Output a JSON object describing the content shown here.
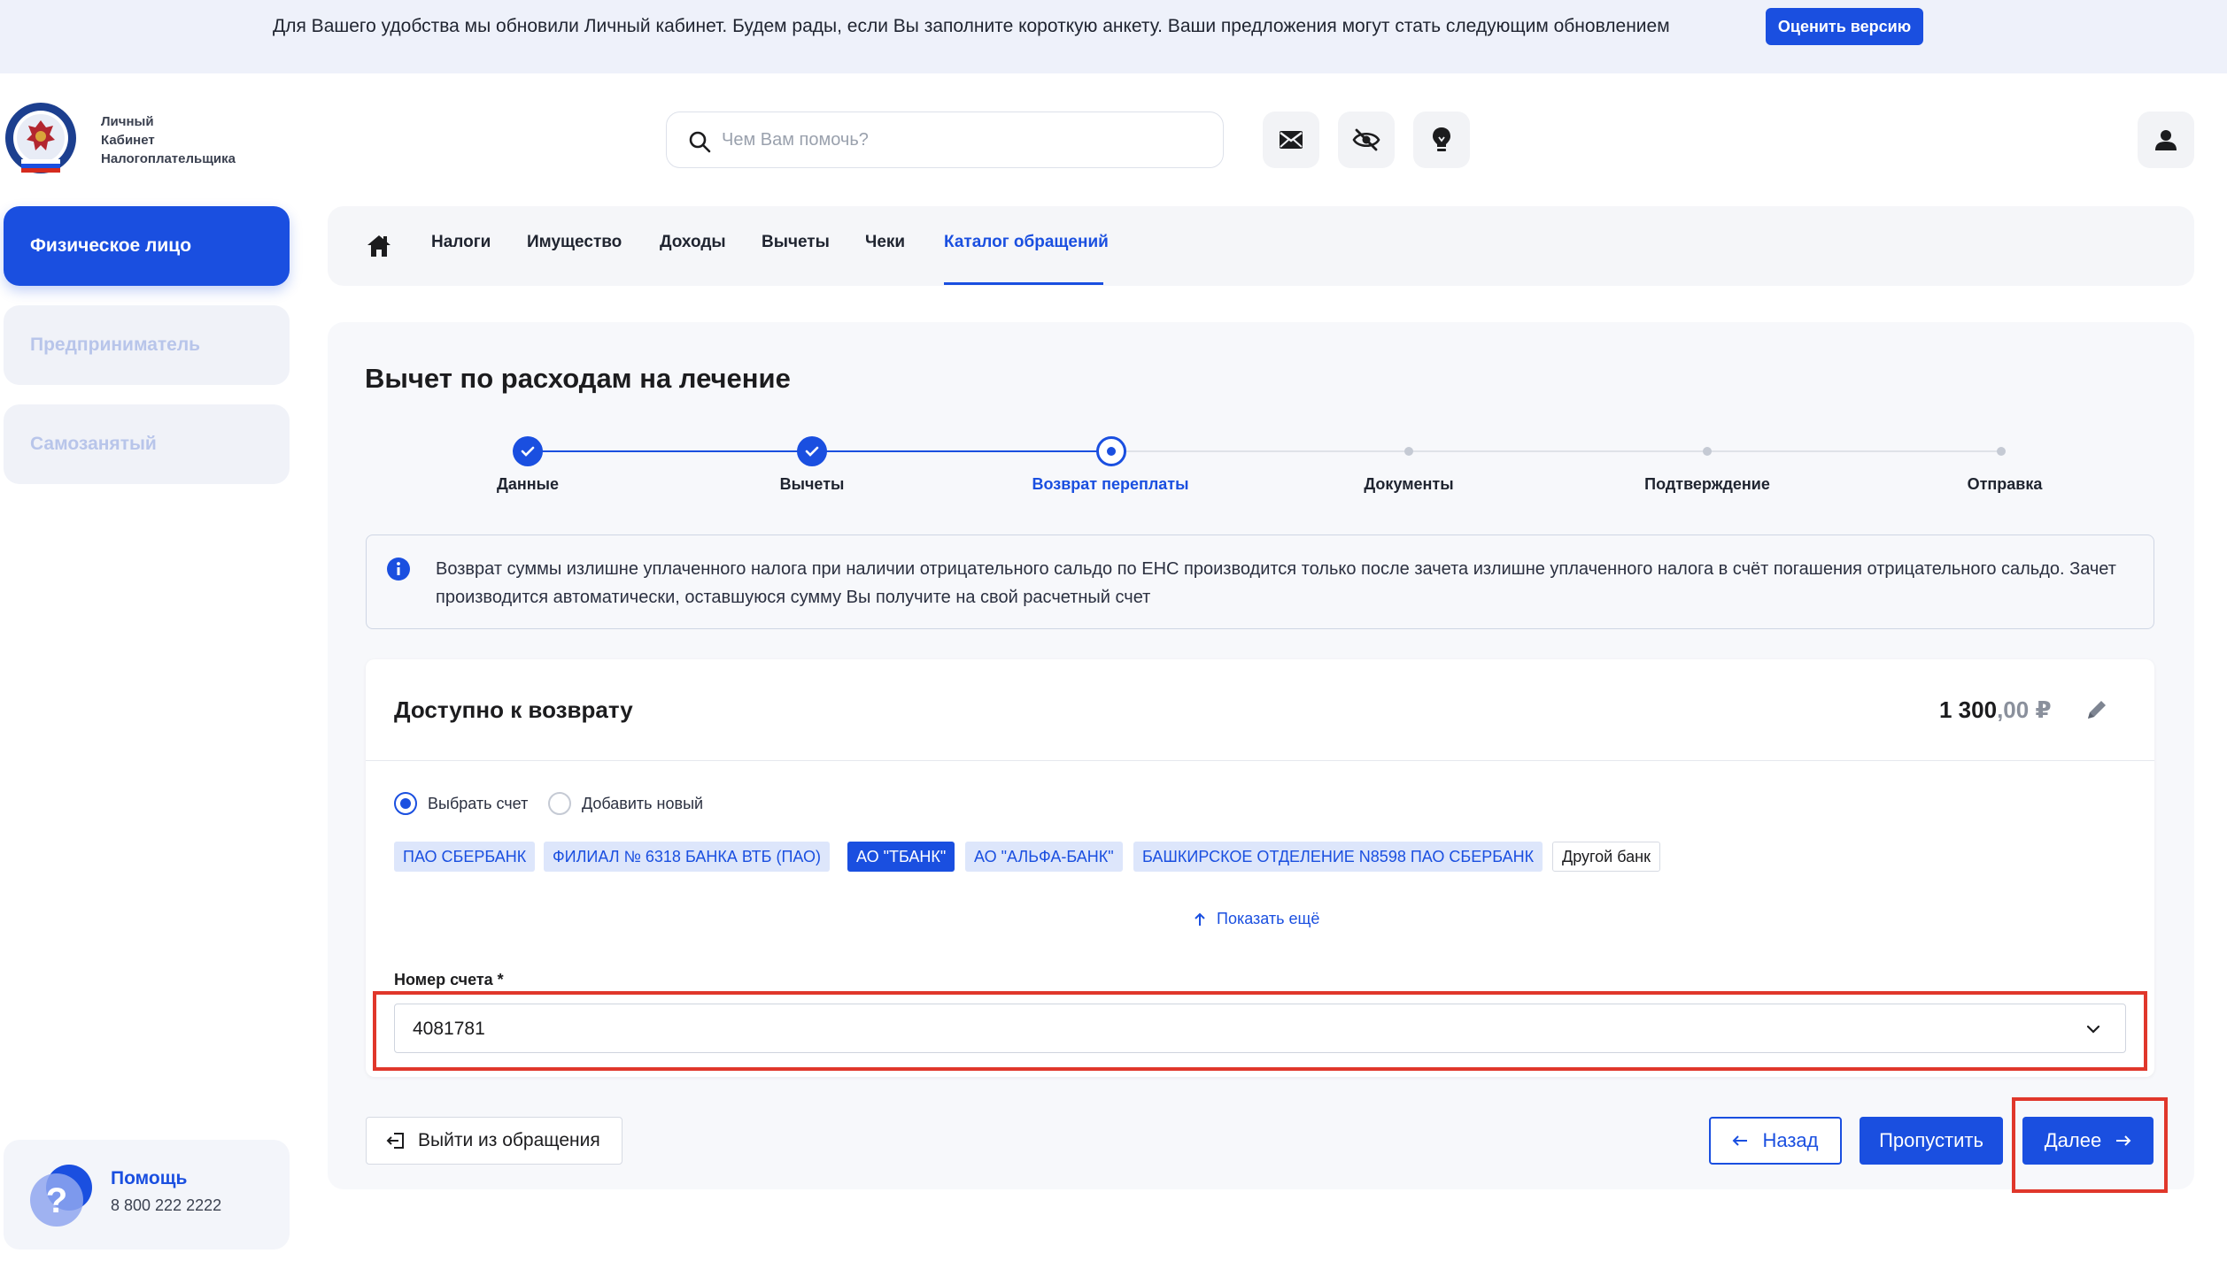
{
  "banner": {
    "text": "Для Вашего удобства мы обновили Личный кабинет. Будем рады, если Вы заполните короткую анкету. Ваши предложения могут стать следующим обновлением",
    "button_label": "Оценить версию"
  },
  "header": {
    "logo_line1": "Личный",
    "logo_line2": "Кабинет",
    "logo_line3": "Налогоплательщика",
    "search_placeholder": "Чем Вам помочь?",
    "icons": [
      "mail-icon",
      "eye-off-icon",
      "lightbulb-icon",
      "user-icon"
    ]
  },
  "sidebar": {
    "items": [
      {
        "label": "Физическое лицо",
        "active": true
      },
      {
        "label": "Предприниматель",
        "active": false
      },
      {
        "label": "Самозанятый",
        "active": false
      }
    ],
    "help_title": "Помощь",
    "help_phone": "8 800 222 2222"
  },
  "nav": {
    "tabs": [
      {
        "label": "Налоги"
      },
      {
        "label": "Имущество"
      },
      {
        "label": "Доходы"
      },
      {
        "label": "Вычеты"
      },
      {
        "label": "Чеки"
      },
      {
        "label": "Каталог обращений",
        "active": true
      }
    ]
  },
  "page": {
    "title": "Вычет по расходам на лечение"
  },
  "stepper": {
    "steps": [
      {
        "label": "Данные",
        "state": "done"
      },
      {
        "label": "Вычеты",
        "state": "done"
      },
      {
        "label": "Возврат переплаты",
        "state": "current"
      },
      {
        "label": "Документы",
        "state": "todo"
      },
      {
        "label": "Подтверждение",
        "state": "todo"
      },
      {
        "label": "Отправка",
        "state": "todo"
      }
    ]
  },
  "info": {
    "text": "Возврат суммы излишне уплаченного налога при наличии отрицательного сальдо по ЕНС производится только после зачета излишне уплаченного налога в счёт погашения отрицательного сальдо. Зачет производится автоматически, оставшуюся сумму Вы получите на свой расчетный счет"
  },
  "refund": {
    "title": "Доступно к возврату",
    "amount_main": "1 300",
    "amount_cents": ",00 ₽",
    "radio_select": "Выбрать счет",
    "radio_add": "Добавить новый",
    "selected_radio": "Выбрать счет",
    "banks": [
      "ПАО СБЕРБАНК",
      "ФИЛИАЛ № 6318 БАНКА ВТБ (ПАО)",
      "АО \"ТБАНК\"",
      "АО \"АЛЬФА-БАНК\"",
      "БАШКИРСКОЕ ОТДЕЛЕНИЕ N8598 ПАО СБЕРБАНК",
      "Другой банк"
    ],
    "selected_bank": "АО \"ТБАНК\"",
    "show_more": "Показать ещё",
    "account_label": "Номер счета *",
    "account_value": "4081781"
  },
  "actions": {
    "exit_label": "Выйти из обращения",
    "back_label": "Назад",
    "skip_label": "Пропустить",
    "next_label": "Далее"
  },
  "colors": {
    "accent": "#1a4fe0",
    "highlight": "#e0372b"
  }
}
